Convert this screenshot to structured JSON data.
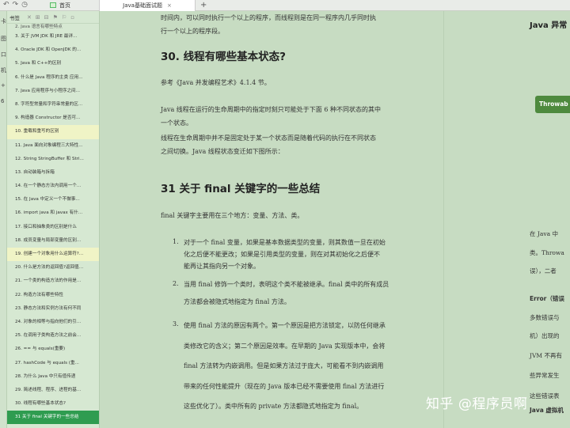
{
  "tabbar": {
    "home_label": "首页",
    "active_tab_label": "Java基础面试题",
    "close_glyph": "×",
    "add_glyph": "+"
  },
  "edge_chars": [
    "卡",
    "图",
    "口",
    "机",
    "+",
    "6"
  ],
  "sidebar": {
    "title": "书签",
    "top_partial": "2. Java 语言有哪些特点",
    "items": [
      {
        "label": "3. 关于 JVM JDK 和 JRE 最详...",
        "state": "normal"
      },
      {
        "label": "4. Oracle JDK 和 OpenJDK 的...",
        "state": "normal"
      },
      {
        "label": "5. Java 和 C++的区别",
        "state": "normal"
      },
      {
        "label": "6. 什么是 Java 程序的主类 应用...",
        "state": "normal"
      },
      {
        "label": "7. Java 应用程序与小程序之间...",
        "state": "normal"
      },
      {
        "label": "8. 字符型常量和字符串常量的区...",
        "state": "normal"
      },
      {
        "label": "9. 构造器 Constructor 是否可...",
        "state": "normal"
      },
      {
        "label": "10. 重载和重写的区别",
        "state": "hl"
      },
      {
        "label": "11. Java 面向对象编程三大特性...",
        "state": "normal"
      },
      {
        "label": "12. String StringBuffer 和 Stri...",
        "state": "normal"
      },
      {
        "label": "13. 自动装箱与拆箱",
        "state": "normal"
      },
      {
        "label": "14. 在一个静态方法内调用一个...",
        "state": "normal"
      },
      {
        "label": "15. 在 Java 中定义一个不做事...",
        "state": "normal"
      },
      {
        "label": "16. import java 和 javax 有什...",
        "state": "normal"
      },
      {
        "label": "17. 接口和抽象类的区别是什么",
        "state": "normal"
      },
      {
        "label": "18. 成员变量与局部变量的区别...",
        "state": "normal"
      },
      {
        "label": "19. 创建一个对象用什么运算符?...",
        "state": "hl"
      },
      {
        "label": "20. 什么是方法的返回值?返回值...",
        "state": "normal"
      },
      {
        "label": "21. 一个类的构造方法的作用是...",
        "state": "normal"
      },
      {
        "label": "22. 构造方法有哪些特性",
        "state": "normal"
      },
      {
        "label": "23. 静态方法和实例方法有何不同",
        "state": "normal"
      },
      {
        "label": "24. 对象的相等与指向他们的引...",
        "state": "normal"
      },
      {
        "label": "25. 在调用子类构造方法之前会...",
        "state": "normal"
      },
      {
        "label": "26. == 与 equals(重要)",
        "state": "normal"
      },
      {
        "label": "27. hashCode 与 equals (重...",
        "state": "normal"
      },
      {
        "label": "28. 为什么 Java 中只有值传递",
        "state": "normal"
      },
      {
        "label": "29. 简述线程、程序、进程的基...",
        "state": "normal"
      },
      {
        "label": "30. 线程有哪些基本状态?",
        "state": "normal"
      },
      {
        "label": "31 关于 final 关键字的一些总结",
        "state": "active"
      }
    ]
  },
  "main": {
    "top_para": [
      "时间内，可以同时执行一个以上的程序，而线程则是在同一程序内几乎同时执",
      "行一个以上的程序段。"
    ],
    "h30": "30. 线程有哪些基本状态?",
    "ref": "参考《Java 并发编程艺术》4.1.4 节。",
    "p1": [
      "Java 线程在运行的生命周期中的指定时刻只可能处于下面 6 种不同状态的其中",
      "一个状态。"
    ],
    "p2": [
      "线程在生命周期中并不是固定处于某一个状态而是随着代码的执行在不同状态",
      "之间切换。Java 线程状态变迁如下图所示："
    ],
    "h31": "31 关于  final  关键字的一些总结",
    "intro": "final 关键字主要用在三个地方：变量、方法、类。",
    "list": [
      {
        "num": "1.",
        "lines": [
          "对于一个 final 变量，如果是基本数据类型的变量，则其数值一旦在初始",
          "化之后便不能更改；如果是引用类型的变量，则在对其初始化之后便不",
          "能再让其指向另一个对象。"
        ]
      },
      {
        "num": "2.",
        "lines": [
          "当用 final 修饰一个类时，表明这个类不能被继承。final 类中的所有成员",
          "方法都会被隐式地指定为 final 方法。"
        ]
      },
      {
        "num": "3.",
        "lines": [
          "使用 final 方法的原因有两个。第一个原因是把方法锁定，以防任何继承",
          "类修改它的含义；第二个原因是效率。在早期的 Java 实现版本中，会将",
          "final 方法转为内嵌调用。但是如果方法过于庞大，可能看不到内嵌调用",
          "带来的任何性能提升（现在的 Java 版本已经不需要使用 final 方法进行",
          "这些优化了）。类中所有的 private 方法都隐式地指定为 final。"
        ]
      }
    ]
  },
  "right": {
    "title": "Java 异常",
    "button": "Throwab",
    "lines": [
      "在 Java 中",
      "类。Throwa",
      "误），二者",
      "Error（错误",
      "多数错误与",
      "机）出现的",
      "JVM 不再有",
      "些异常发生",
      "这些错误表",
      "Java 虚拟机"
    ]
  },
  "watermark": "知乎 @程序员啊"
}
